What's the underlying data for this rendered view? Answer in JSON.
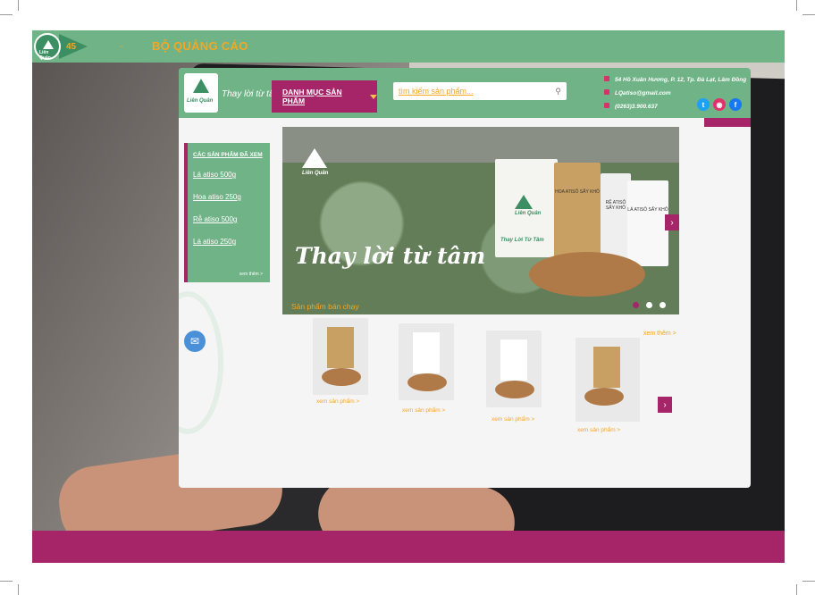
{
  "header": {
    "page_number": "45",
    "dash": "-",
    "section_title": "BỘ QUẢNG CÁO"
  },
  "colors": {
    "green": "#6fb386",
    "dark_green": "#3c8f63",
    "magenta": "#a62468",
    "accent": "#f6a623"
  },
  "website": {
    "logo_text": "Liên Quân",
    "slogan": "Thay lời từ tâm",
    "category_button": "DANH MỤC SẢN PHẨM",
    "search_placeholder": "tìm kiếm sản phẩm...",
    "contact": {
      "address": "54 Hồ Xuân Hương, P. 12, Tp. Đà Lạt, Lâm Đồng",
      "email": "LQatiso@gmail.com",
      "phone": "(0263)3.900.637"
    },
    "socials": [
      "twitter-icon",
      "instagram-icon",
      "facebook-icon"
    ],
    "sidebar": {
      "title": "CÁC SẢN PHẨM ĐÃ XEM",
      "items": [
        "Lá atiso 500g",
        "Hoa atiso 250g",
        "Rễ atiso 500g",
        "Lá atiso 250g"
      ],
      "more": "xem thêm >"
    },
    "banner": {
      "logo_text": "Liên Quân",
      "slogan": "Thay lời từ tâm",
      "bag_brand": "Liên Quân",
      "bag_slogan": "Thay Lời Từ Tâm",
      "bags": [
        "HOA ATISÔ SẤY KHÔ",
        "RỄ ATISÔ SẤY KHÔ",
        "LÁ ATISÔ SẤY KHÔ"
      ]
    },
    "best_sellers": {
      "title": "Sản phẩm bán chạy",
      "see_more": "xem thêm >",
      "product_links": [
        "xem sản phẩm >",
        "xem sản phẩm >",
        "xem sản phẩm >",
        "xem sản phẩm >"
      ]
    }
  }
}
